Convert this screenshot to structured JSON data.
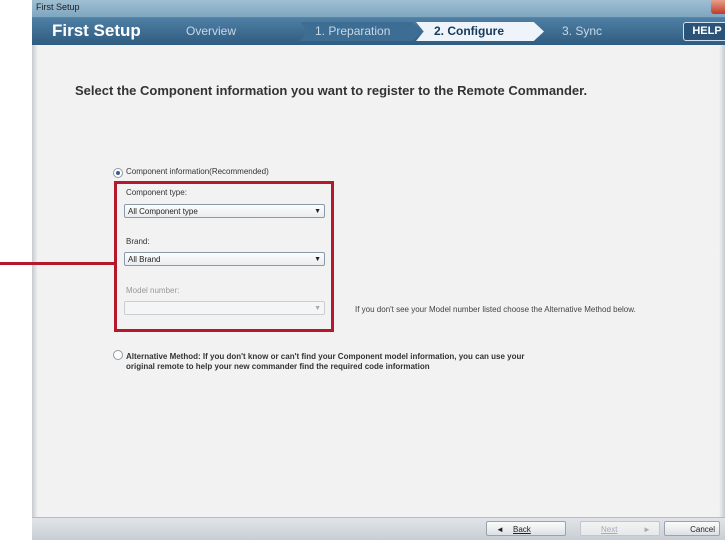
{
  "window": {
    "title": "First Setup"
  },
  "header": {
    "app_title": "First Setup",
    "steps": [
      {
        "label": "Overview"
      },
      {
        "label": "1. Preparation"
      },
      {
        "label": "2. Configure"
      },
      {
        "label": "3. Sync"
      }
    ],
    "active_step": "2. Configure",
    "help_label": "HELP"
  },
  "main": {
    "instruction": "Select the Component information you want to register to the Remote Commander.",
    "option_recommended": {
      "label": "Component information(Recommended)",
      "selected": true,
      "component_type": {
        "label": "Component type:",
        "value": "All Component type"
      },
      "brand": {
        "label": "Brand:",
        "value": "All Brand"
      },
      "model_number": {
        "label": "Model number:",
        "value": "",
        "disabled": true
      },
      "hint": "If you don't see your Model number listed choose the Alternative Method below."
    },
    "option_alternative": {
      "label": "Alternative Method: If you don't know or can't find your Component model information, you can use your original remote to help your new commander find the required code information",
      "selected": false
    }
  },
  "footer": {
    "back_label": "Back",
    "next_label": "Next",
    "cancel_label": "Cancel"
  },
  "colors": {
    "highlight": "#b3192b",
    "header": "#2f5c80",
    "accent_step": "#eef4f9"
  },
  "icons": {
    "back": "left-arrow-icon",
    "next": "right-arrow-icon",
    "dropdown": "chevron-down-icon"
  }
}
